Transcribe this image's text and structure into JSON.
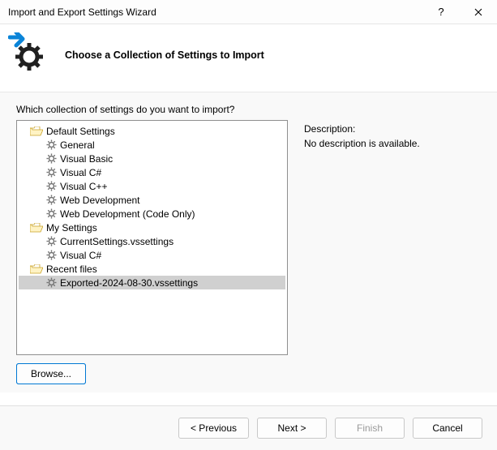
{
  "window": {
    "title": "Import and Export Settings Wizard"
  },
  "header": {
    "heading": "Choose a Collection of Settings to Import"
  },
  "main": {
    "prompt": "Which collection of settings do you want to import?",
    "desc_label": "Description:",
    "desc_text": "No description is available.",
    "browse_label": "Browse..."
  },
  "tree": {
    "f0": "Default Settings",
    "i0": "General",
    "i1": "Visual Basic",
    "i2": "Visual C#",
    "i3": "Visual C++",
    "i4": "Web Development",
    "i5": "Web Development (Code Only)",
    "f1": "My Settings",
    "i6": "CurrentSettings.vssettings",
    "i7": "Visual C#",
    "f2": "Recent files",
    "i8": "Exported-2024-08-30.vssettings"
  },
  "footer": {
    "prev": "< Previous",
    "next": "Next >",
    "finish": "Finish",
    "cancel": "Cancel"
  }
}
